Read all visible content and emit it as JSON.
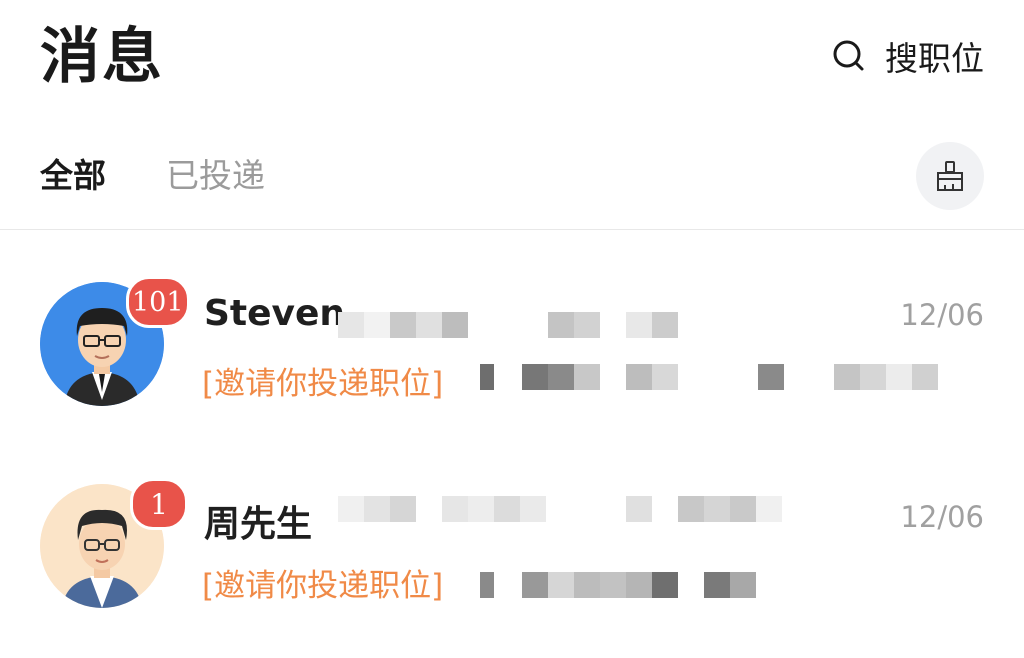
{
  "header": {
    "title": "消息",
    "search_label": "搜职位"
  },
  "tabs": [
    {
      "label": "全部",
      "active": true
    },
    {
      "label": "已投递",
      "active": false
    }
  ],
  "clear_icon": "broom-icon",
  "messages": [
    {
      "name": "Steven",
      "badge": "101",
      "date": "12/06",
      "preview": "[邀请你投递职位]",
      "avatar": "avatar-man-suit"
    },
    {
      "name": "周先生",
      "badge": "1",
      "date": "12/06",
      "preview": "[邀请你投递职位]",
      "avatar": "avatar-man-glasses"
    }
  ],
  "colors": {
    "badge": "#e8534a",
    "preview": "#f08a47",
    "date": "#a0a0a0",
    "inactive_tab": "#9b9b9b"
  }
}
